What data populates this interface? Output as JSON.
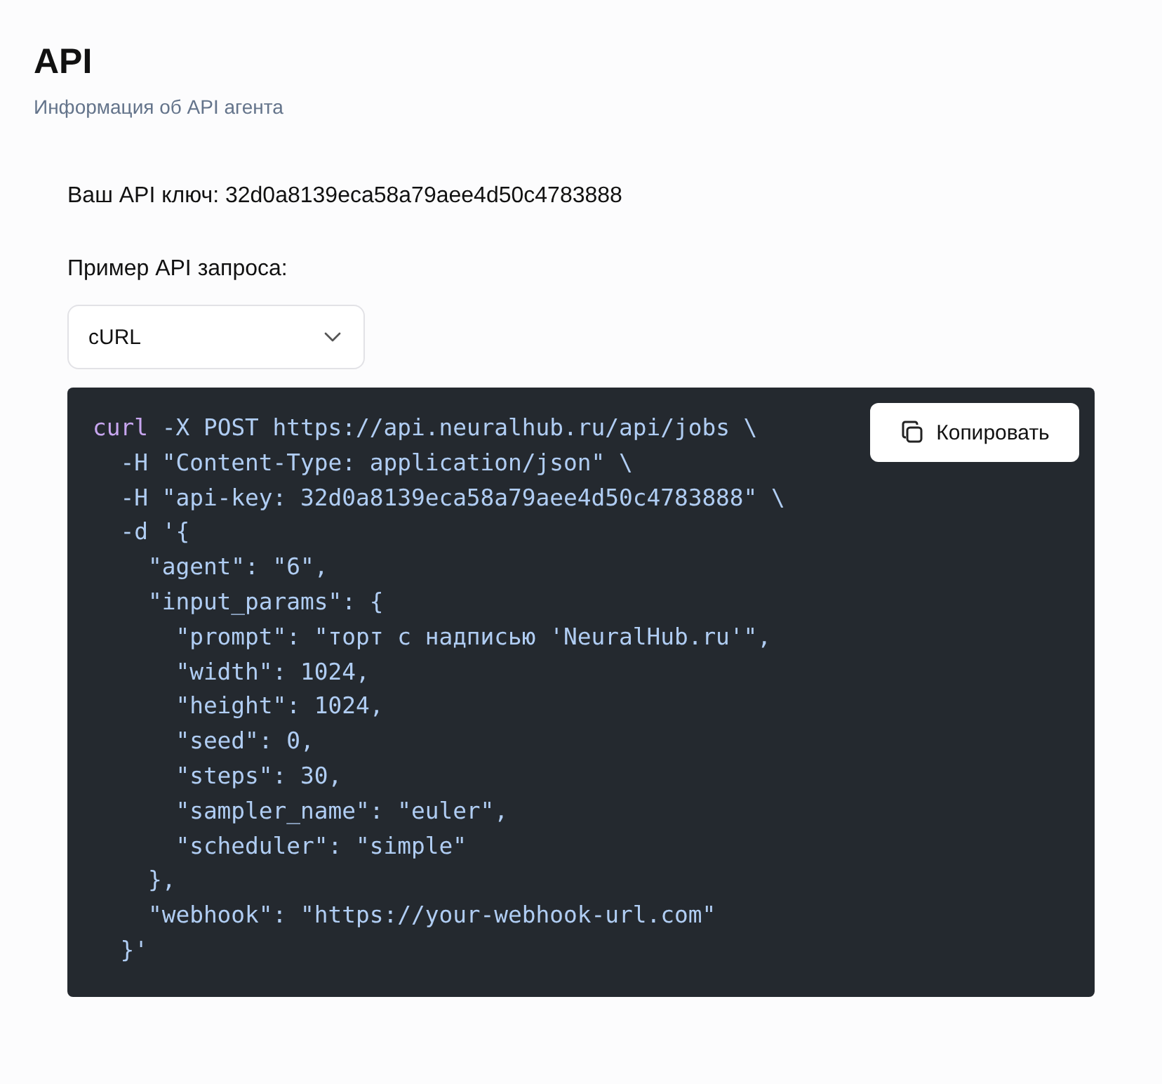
{
  "header": {
    "title": "API",
    "subtitle": "Информация об API агента"
  },
  "api_key": {
    "label": "Ваш API ключ:",
    "value": "32d0a8139eca58a79aee4d50c4783888"
  },
  "request_example": {
    "label": "Пример API запроса:",
    "select": {
      "value": "cURL"
    }
  },
  "code": {
    "copy_button": "Копировать",
    "lines": [
      [
        {
          "kind": "command",
          "text": "curl"
        },
        {
          "kind": "plain",
          "text": " -X POST https://api.neuralhub.ru/api/jobs \\"
        }
      ],
      [
        {
          "kind": "plain",
          "text": "  -H \"Content-Type: application/json\" \\"
        }
      ],
      [
        {
          "kind": "plain",
          "text": "  -H \"api-key: 32d0a8139eca58a79aee4d50c4783888\" \\"
        }
      ],
      [
        {
          "kind": "plain",
          "text": "  -d '{"
        }
      ],
      [
        {
          "kind": "plain",
          "text": "    \"agent\": \"6\","
        }
      ],
      [
        {
          "kind": "plain",
          "text": "    \"input_params\": {"
        }
      ],
      [
        {
          "kind": "plain",
          "text": "      \"prompt\": \"торт с надписью 'NeuralHub.ru'\","
        }
      ],
      [
        {
          "kind": "plain",
          "text": "      \"width\": 1024,"
        }
      ],
      [
        {
          "kind": "plain",
          "text": "      \"height\": 1024,"
        }
      ],
      [
        {
          "kind": "plain",
          "text": "      \"seed\": 0,"
        }
      ],
      [
        {
          "kind": "plain",
          "text": "      \"steps\": 30,"
        }
      ],
      [
        {
          "kind": "plain",
          "text": "      \"sampler_name\": \"euler\","
        }
      ],
      [
        {
          "kind": "plain",
          "text": "      \"scheduler\": \"simple\""
        }
      ],
      [
        {
          "kind": "plain",
          "text": "    },"
        }
      ],
      [
        {
          "kind": "plain",
          "text": "    \"webhook\": \"https://your-webhook-url.com\""
        }
      ],
      [
        {
          "kind": "plain",
          "text": "  }'"
        }
      ]
    ]
  }
}
